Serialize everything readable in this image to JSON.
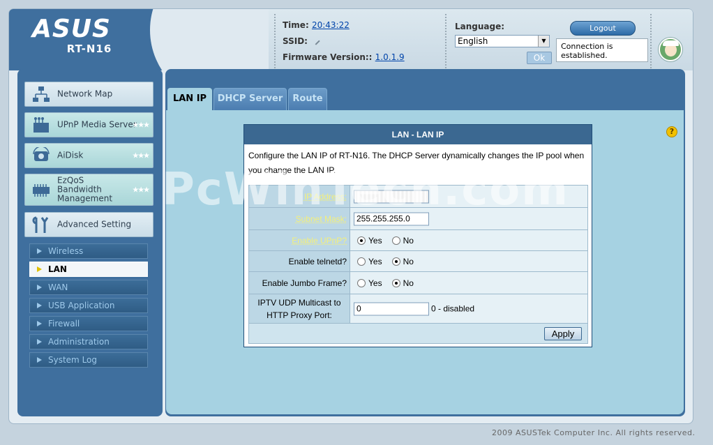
{
  "brand": {
    "logo": "ASUS",
    "model": "RT-N16"
  },
  "header": {
    "time_label": "Time:",
    "time_value": "20:43:22",
    "ssid_label": "SSID:",
    "firmware_label": "Firmware Version::",
    "firmware_value": "1.0.1.9",
    "language_label": "Language:",
    "language_value": "English",
    "ok_label": "Ok",
    "logout_label": "Logout",
    "connection_status": "Connection is established."
  },
  "sidebar": {
    "items": [
      {
        "label": "Network Map",
        "icon": "network-map-icon"
      },
      {
        "label": "UPnP Media Server",
        "icon": "media-server-icon",
        "stars": "★★★"
      },
      {
        "label": "AiDisk",
        "icon": "aidisk-icon",
        "stars": "★★★"
      },
      {
        "label": "EzQoS Bandwidth Management",
        "icon": "ezqos-icon",
        "stars": "★★★"
      },
      {
        "label": "Advanced Setting",
        "icon": "advanced-setting-icon"
      }
    ],
    "sub_items": [
      {
        "label": "Wireless",
        "active": false
      },
      {
        "label": "LAN",
        "active": true
      },
      {
        "label": "WAN",
        "active": false
      },
      {
        "label": "USB Application",
        "active": false
      },
      {
        "label": "Firewall",
        "active": false
      },
      {
        "label": "Administration",
        "active": false
      },
      {
        "label": "System Log",
        "active": false
      }
    ]
  },
  "tabs": [
    {
      "label": "LAN IP",
      "active": true
    },
    {
      "label": "DHCP Server",
      "active": false
    },
    {
      "label": "Route",
      "active": false
    }
  ],
  "panel": {
    "title": "LAN - LAN IP",
    "description": "Configure the LAN IP of RT-N16. The DHCP Server dynamically changes the IP pool when you change the LAN IP.",
    "fields": {
      "ip_address_label": "IP Address:",
      "ip_address_value": "",
      "subnet_mask_label": "Subnet Mask:",
      "subnet_mask_value": "255.255.255.0",
      "upnp_label": "Enable UPnP?",
      "telnetd_label": "Enable telnetd?",
      "jumbo_label": "Enable Jumbo Frame?",
      "yes_label": "Yes",
      "no_label": "No",
      "iptv_label_1": "IPTV UDP Multicast to",
      "iptv_label_2": "HTTP Proxy Port:",
      "iptv_value": "0",
      "iptv_suffix": "0 - disabled"
    },
    "apply_label": "Apply"
  },
  "watermark": "PcWinTech.com",
  "footer": "2009 ASUSTek Computer Inc. All rights reserved.",
  "help_icon": "?",
  "colors": {
    "primary_blue": "#3f6f9e",
    "content_bg": "#a6d2e2",
    "panel_title_bg": "#3b6891",
    "link_yellow": "#f5f07a"
  }
}
